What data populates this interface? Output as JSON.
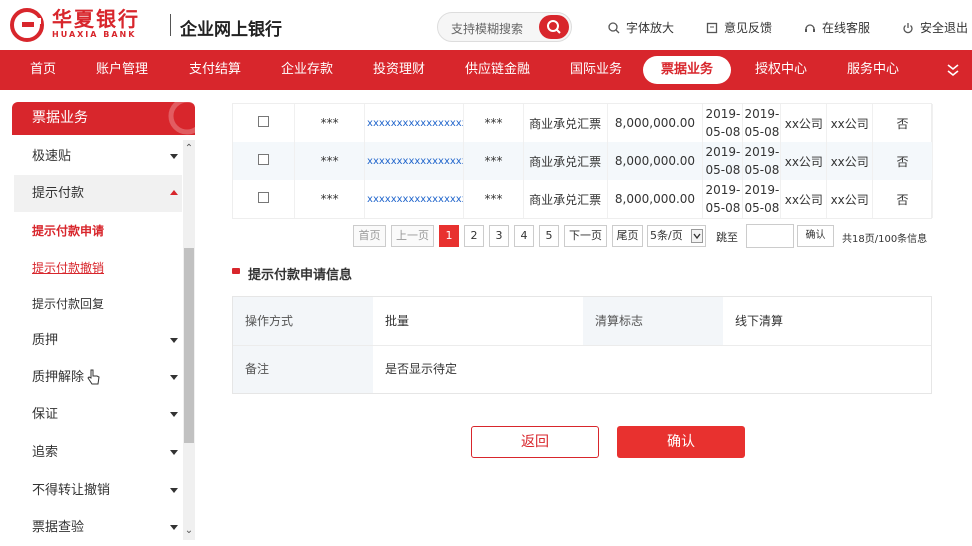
{
  "brand": {
    "name_cn": "华夏银行",
    "name_en": "HUAXIA BANK",
    "portal": "企业网上银行"
  },
  "search": {
    "placeholder": "支持模糊搜索"
  },
  "tools": {
    "font_zoom": "字体放大",
    "feedback": "意见反馈",
    "service": "在线客服",
    "logout": "安全退出"
  },
  "nav": {
    "items": [
      "首页",
      "账户管理",
      "支付结算",
      "企业存款",
      "投资理财",
      "供应链金融",
      "国际业务",
      "票据业务",
      "授权中心",
      "服务中心"
    ],
    "active": "票据业务"
  },
  "sidebar": {
    "title": "票据业务",
    "items": [
      "极速贴",
      "提示付款",
      "质押",
      "质押解除",
      "保证",
      "追索",
      "不得转让撤销",
      "票据查验"
    ],
    "sub_items": [
      "提示付款申请",
      "提示付款撤销",
      "提示付款回复"
    ]
  },
  "table": {
    "rows": [
      {
        "c1": "***",
        "account": "xxxxxxxxxxxxxxxxxxxx",
        "c3": "***",
        "type": "商业承兑汇票",
        "amount": "8,000,000.00",
        "date1": [
          "2019-",
          "05-08"
        ],
        "date2": [
          "2019-",
          "05-08"
        ],
        "drawer": "xx公司",
        "payee": "xx公司",
        "flag": "否"
      },
      {
        "c1": "***",
        "account": "xxxxxxxxxxxxxxxxxxxx",
        "c3": "***",
        "type": "商业承兑汇票",
        "amount": "8,000,000.00",
        "date1": [
          "2019-",
          "05-08"
        ],
        "date2": [
          "2019-",
          "05-08"
        ],
        "drawer": "xx公司",
        "payee": "xx公司",
        "flag": "否"
      },
      {
        "c1": "***",
        "account": "xxxxxxxxxxxxxxxxxxxx",
        "c3": "***",
        "type": "商业承兑汇票",
        "amount": "8,000,000.00",
        "date1": [
          "2019-",
          "05-08"
        ],
        "date2": [
          "2019-",
          "05-08"
        ],
        "drawer": "xx公司",
        "payee": "xx公司",
        "flag": "否"
      }
    ]
  },
  "pager": {
    "first": "首页",
    "prev": "上一页",
    "pages": [
      "1",
      "2",
      "3",
      "4",
      "5"
    ],
    "current": "1",
    "next": "下一页",
    "last": "尾页",
    "page_size": "5条/页",
    "goto_label": "跳至",
    "confirm": "确认",
    "summary": "共18页/100条信息"
  },
  "section": {
    "title": "提示付款申请信息"
  },
  "info": {
    "op_label": "操作方式",
    "op_value": "批量",
    "clear_label": "清算标志",
    "clear_value": "线下清算",
    "remark_label": "备注",
    "remark_value": "是否显示待定"
  },
  "buttons": {
    "back": "返回",
    "confirm": "确认"
  },
  "colors": {
    "brand_red": "#d8262c",
    "link_blue": "#2266cc"
  }
}
